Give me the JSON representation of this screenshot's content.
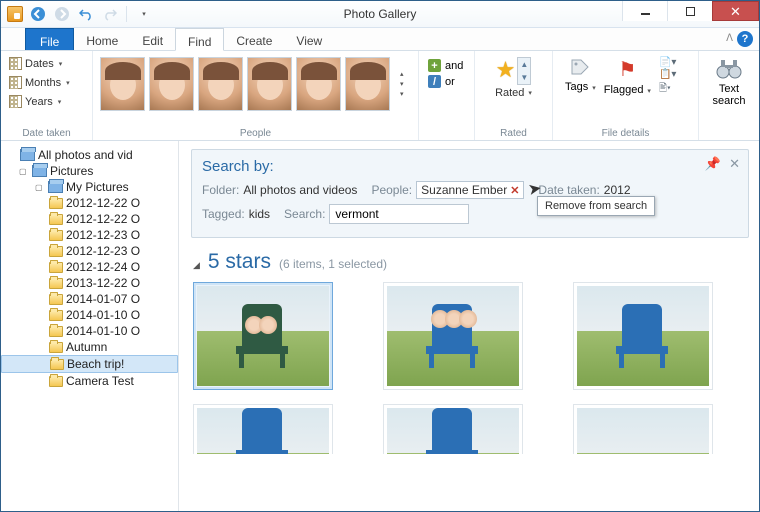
{
  "title": "Photo Gallery",
  "window_controls": {
    "minimize": "Minimize",
    "maximize": "Maximize",
    "close": "Close"
  },
  "qat": {
    "back": "Back",
    "forward": "Forward",
    "undo": "Undo",
    "redo": "Redo"
  },
  "menu": {
    "file": "File",
    "tabs": [
      "Home",
      "Edit",
      "Find",
      "Create",
      "View"
    ],
    "active": "Find"
  },
  "ribbon": {
    "date_taken": {
      "dates": "Dates",
      "months": "Months",
      "years": "Years",
      "group": "Date taken"
    },
    "people_group": "People",
    "andor": {
      "and": "and",
      "or": "or"
    },
    "rated": {
      "label": "Rated",
      "group": "Rated"
    },
    "file_details": {
      "tags": "Tags",
      "flagged": "Flagged",
      "group": "File details"
    },
    "text_search": {
      "label": "Text search"
    }
  },
  "tree": {
    "root": "All photos and vid",
    "pictures": "Pictures",
    "my_pictures": "My Pictures",
    "folders": [
      "2012-12-22 O",
      "2012-12-22 O",
      "2012-12-23 O",
      "2012-12-23 O",
      "2012-12-24 O",
      "2013-12-22 O",
      "2014-01-07 O",
      "2014-01-10 O",
      "2014-01-10 O",
      "Autumn",
      "Beach trip!",
      "Camera Test"
    ]
  },
  "search_by": {
    "title": "Search by:",
    "folder_label": "Folder:",
    "folder_value": "All photos and videos",
    "people_label": "People:",
    "people_value": "Suzanne Ember",
    "date_label": "Date taken:",
    "date_value": "2012",
    "tagged_label": "Tagged:",
    "tagged_value": "kids",
    "search_label": "Search:",
    "search_value": "vermont",
    "tooltip": "Remove from search"
  },
  "results": {
    "heading": "5 stars",
    "count": "(6 items, 1 selected)"
  }
}
